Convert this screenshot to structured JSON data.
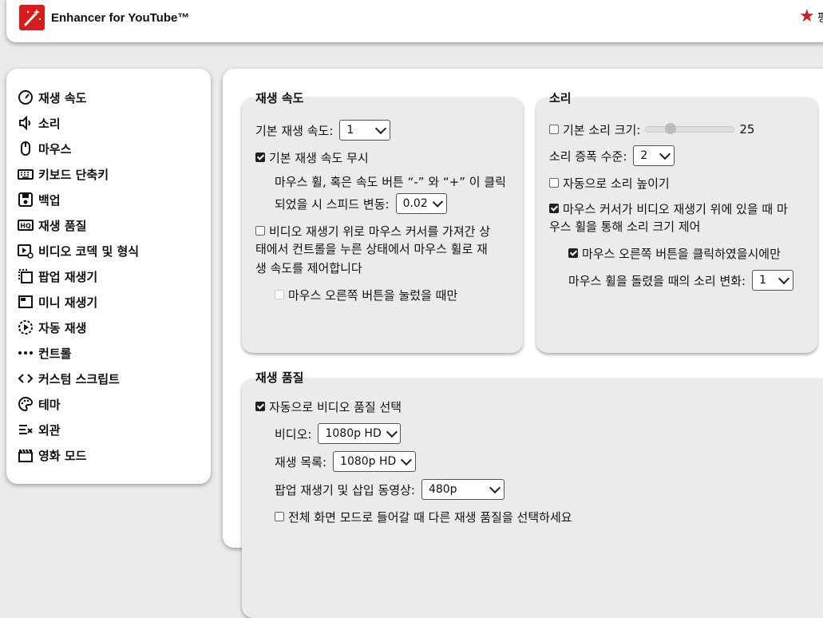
{
  "header": {
    "title": "Enhancer for YouTube™",
    "star_text": "평"
  },
  "sidebar": {
    "items": [
      {
        "label": "재생 속도",
        "icon": "speedometer-icon"
      },
      {
        "label": "소리",
        "icon": "volume-icon"
      },
      {
        "label": "마우스",
        "icon": "mouse-icon"
      },
      {
        "label": "키보드 단축키",
        "icon": "keyboard-icon"
      },
      {
        "label": "백업",
        "icon": "save-icon"
      },
      {
        "label": "재생 품질",
        "icon": "hq-icon"
      },
      {
        "label": "비디오 코덱 및 형식",
        "icon": "video-settings-icon"
      },
      {
        "label": "팝업 재생기",
        "icon": "popup-icon"
      },
      {
        "label": "미니 재생기",
        "icon": "mini-player-icon"
      },
      {
        "label": "자동 재생",
        "icon": "autoplay-icon"
      },
      {
        "label": "컨트롤",
        "icon": "more-icon"
      },
      {
        "label": "커스텀 스크립트",
        "icon": "code-icon"
      },
      {
        "label": "테마",
        "icon": "palette-icon"
      },
      {
        "label": "외관",
        "icon": "appearance-icon"
      },
      {
        "label": "영화 모드",
        "icon": "clapperboard-icon"
      }
    ]
  },
  "speed_card": {
    "title": "재생 속도",
    "default_speed_label": "기본 재생 속도:",
    "default_speed_value": "1",
    "ignore_default_label": "기본 재생 속도 무시",
    "ignore_default_checked": true,
    "wheel_text_line1": "마우스 휠, 혹은 속도 버튼 “-” 와 “+” 이 클릭",
    "wheel_text_line2": "되었을 시 스피드 변동:",
    "wheel_step_value": "0.02",
    "control_label_line1": "비디오 재생기 위로 마우스 커서를 가져간 상",
    "control_label_line2": "태에서 컨트롤을 누른 상태에서 마우스 휠로 재",
    "control_label_line3": "생 속도를 제어합니다",
    "control_checked": false,
    "right_button_label": "마우스 오른쪽 버튼을 눌렀을 때만",
    "right_button_checked": false
  },
  "sound_card": {
    "title": "소리",
    "default_volume_label": "기본 소리 크기:",
    "default_volume_checked": false,
    "default_volume_value": "25",
    "default_volume_fraction": 0.25,
    "boost_label": "소리 증폭 수준:",
    "boost_value": "2",
    "auto_raise_label": "자동으로 소리 높이기",
    "auto_raise_checked": false,
    "wheel_label_line1": "마우스 커서가 비디오 재생기 위에 있을 때 마",
    "wheel_label_line2": "우스 휠을 통해 소리 크기 제어",
    "wheel_checked": true,
    "right_click_label": "마우스 오른쪽 버튼을 클릭하였을시에만",
    "right_click_checked": true,
    "wheel_change_label": "마우스 휠을 돌렸을 때의 소리 변화:",
    "wheel_change_value": "1"
  },
  "quality_card": {
    "title": "재생 품질",
    "auto_quality_label": "자동으로 비디오 품질 선택",
    "auto_quality_checked": true,
    "video_label": "비디오:",
    "video_value": "1080p HD",
    "playlist_label": "재생 목록:",
    "playlist_value": "1080p HD",
    "popup_label": "팝업 재생기 및 삽입 동영상:",
    "popup_value": "480p",
    "fullscreen_label": "전체 화면 모드로 들어갈 때 다른 재생 품질을 선택하세요"
  }
}
